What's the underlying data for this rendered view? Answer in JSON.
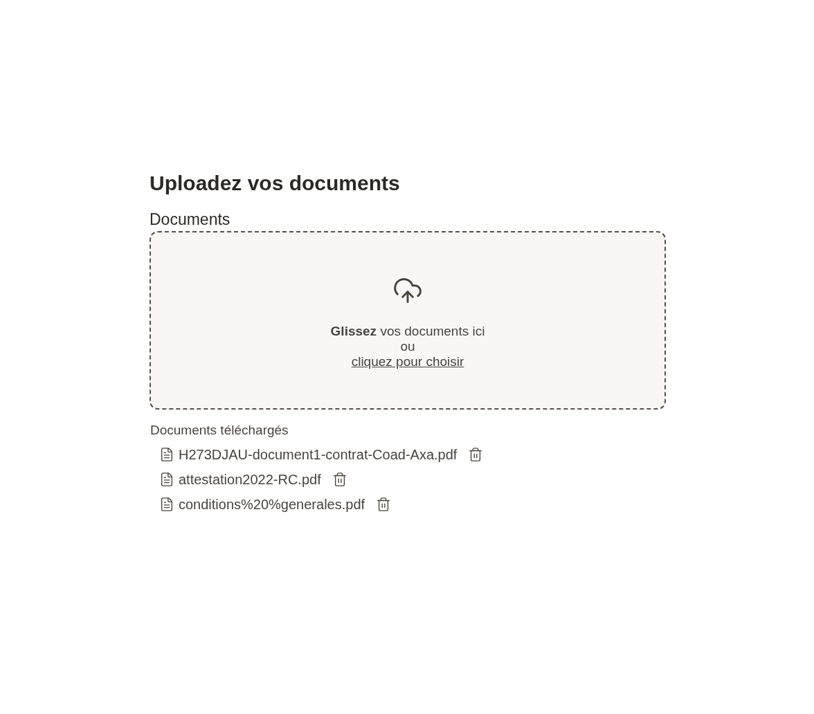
{
  "title": "Uploadez vos documents",
  "field_label": "Documents",
  "dropzone": {
    "instruction": "**Glissez** vos documents ici",
    "separator": "ou",
    "link": "cliquez pour choisir"
  },
  "uploaded": {
    "heading": "Documents téléchargés",
    "files": [
      {
        "name": "H273DJAU-document1-contrat-Coad-Axa.pdf"
      },
      {
        "name": "attestation2022-RC.pdf"
      },
      {
        "name": "conditions%20%generales.pdf"
      }
    ]
  }
}
